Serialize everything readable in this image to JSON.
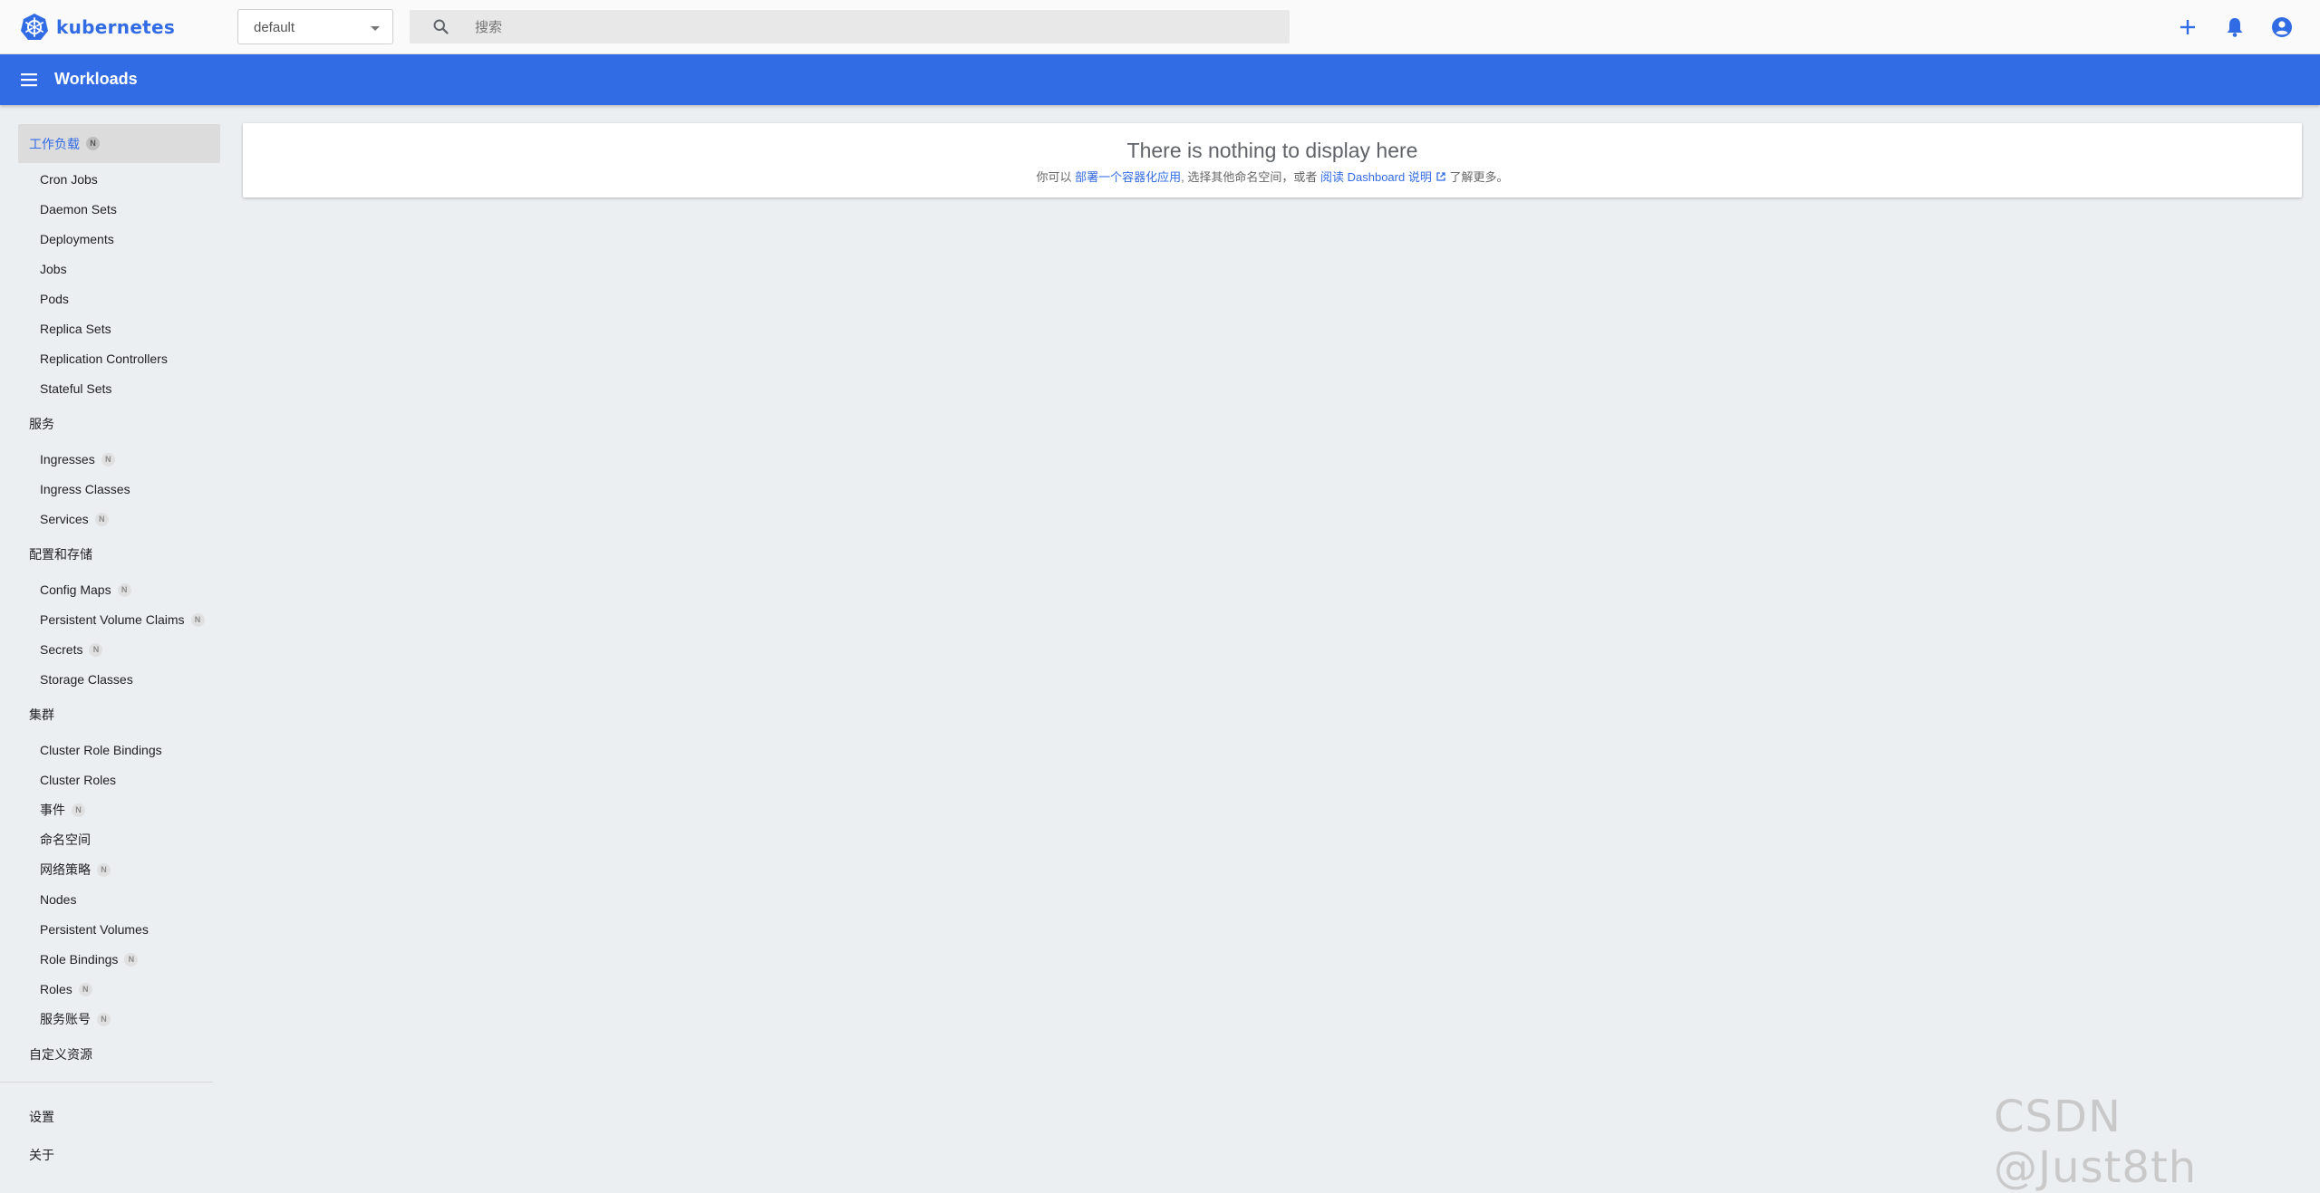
{
  "header": {
    "brand": "kubernetes",
    "namespace": "default",
    "search_placeholder": "搜索"
  },
  "titlebar": {
    "title": "Workloads"
  },
  "sidebar": {
    "workloads": {
      "label": "工作负载",
      "badge": "N"
    },
    "workload_items": [
      "Cron Jobs",
      "Daemon Sets",
      "Deployments",
      "Jobs",
      "Pods",
      "Replica Sets",
      "Replication Controllers",
      "Stateful Sets"
    ],
    "service": {
      "label": "服务"
    },
    "service_items": [
      {
        "label": "Ingresses",
        "badge": "N"
      },
      {
        "label": "Ingress Classes"
      },
      {
        "label": "Services",
        "badge": "N"
      }
    ],
    "config": {
      "label": "配置和存储"
    },
    "config_items": [
      {
        "label": "Config Maps",
        "badge": "N"
      },
      {
        "label": "Persistent Volume Claims",
        "badge": "N"
      },
      {
        "label": "Secrets",
        "badge": "N"
      },
      {
        "label": "Storage Classes"
      }
    ],
    "cluster": {
      "label": "集群"
    },
    "cluster_items": [
      {
        "label": "Cluster Role Bindings"
      },
      {
        "label": "Cluster Roles"
      },
      {
        "label": "事件",
        "badge": "N"
      },
      {
        "label": "命名空间"
      },
      {
        "label": "网络策略",
        "badge": "N"
      },
      {
        "label": "Nodes"
      },
      {
        "label": "Persistent Volumes"
      },
      {
        "label": "Role Bindings",
        "badge": "N"
      },
      {
        "label": "Roles",
        "badge": "N"
      },
      {
        "label": "服务账号",
        "badge": "N"
      }
    ],
    "crd": {
      "label": "自定义资源"
    },
    "settings": {
      "label": "设置"
    },
    "about": {
      "label": "关于"
    }
  },
  "main": {
    "empty_title": "There is nothing to display here",
    "empty_pre": "你可以 ",
    "empty_link1": "部署一个容器化应用",
    "empty_mid": ", 选择其他命名空间，或者 ",
    "empty_link2": "阅读 Dashboard 说明",
    "empty_post": " 了解更多。"
  },
  "watermark": "CSDN @Just8th",
  "colors": {
    "accent": "#326ce5",
    "background": "#eceff2"
  }
}
